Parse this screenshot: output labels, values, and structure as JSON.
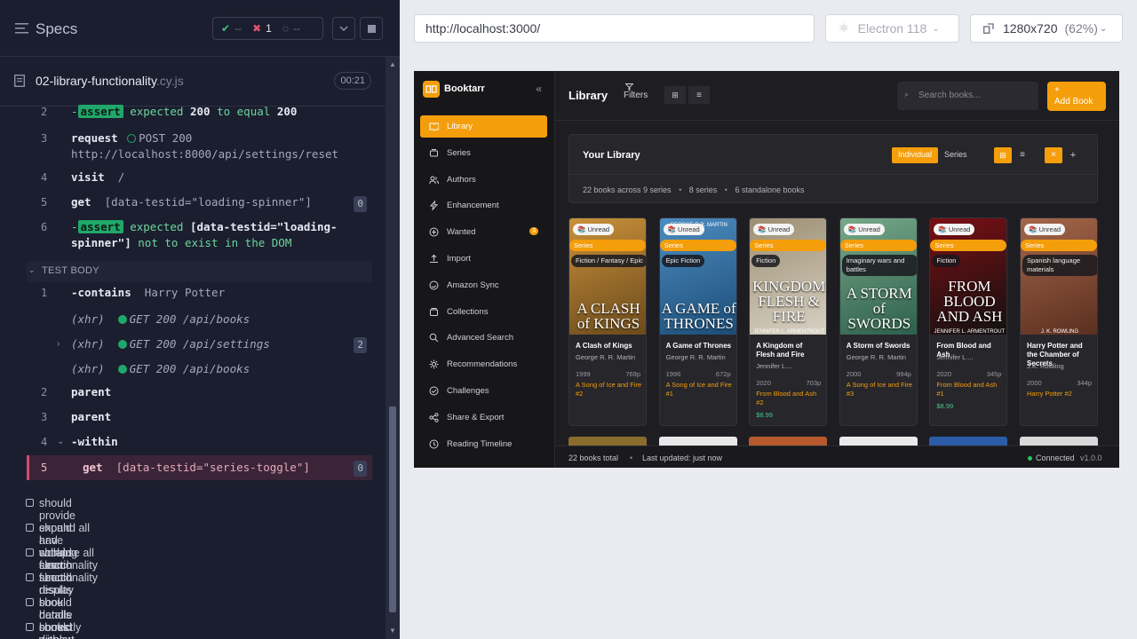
{
  "reporter": {
    "title": "Specs",
    "stats": {
      "passed": "--",
      "failed": "1",
      "pending": "--"
    },
    "file": {
      "name": "02-library-functionality",
      "ext": ".cy.js",
      "duration": "00:21"
    },
    "commands": [
      {
        "num": "2",
        "prefix": "-",
        "badge": "assert",
        "text1": "expected",
        "val1": "200",
        "text2": "to equal",
        "val2": "200"
      },
      {
        "num": "3",
        "name": "request",
        "method": "POST 200",
        "url": "http://localhost:8000/api/settings/reset"
      },
      {
        "num": "4",
        "name": "visit",
        "arg": "/"
      },
      {
        "num": "5",
        "name": "get",
        "arg": "[data-testid=\"loading-spinner\"]",
        "count": "0"
      },
      {
        "num": "6",
        "prefix": "-",
        "badge": "assert",
        "text1": "expected",
        "val1": "[data-testid=\"loading-",
        "val1b": "spinner\"]",
        "text2": "not to exist in the DOM"
      }
    ],
    "test_body_label": "TEST BODY",
    "body": [
      {
        "num": "1",
        "name": "-contains",
        "arg": "Harry Potter"
      },
      {
        "xhr": "(xhr)",
        "req": "GET 200 /api/books"
      },
      {
        "xhr": "(xhr)",
        "req": "GET 200 /api/settings",
        "count": "2"
      },
      {
        "xhr": "(xhr)",
        "req": "GET 200 /api/books"
      },
      {
        "num": "2",
        "name": "parent"
      },
      {
        "num": "3",
        "name": "parent"
      },
      {
        "num": "4",
        "name": "-within"
      },
      {
        "num": "5",
        "name": "get",
        "arg": "[data-testid=\"series-toggle\"]",
        "count": "0"
      }
    ],
    "tests": [
      "should provide expand all and collapse all functionality",
      "should have working search functionality",
      "should clear search results",
      "should display book details correctly",
      "should handle books without series correctly",
      "should display library statistics"
    ]
  },
  "browser": {
    "url": "http://localhost:3000/",
    "browser_name": "Electron 118",
    "viewport": "1280x720",
    "zoom": "(62%)"
  },
  "app": {
    "brand": "Booktarr",
    "nav": [
      {
        "label": "Library",
        "icon": "book-open-icon",
        "active": true
      },
      {
        "label": "Series",
        "icon": "layers-icon"
      },
      {
        "label": "Authors",
        "icon": "users-icon"
      },
      {
        "label": "Enhancement",
        "icon": "bolt-icon"
      },
      {
        "label": "Wanted",
        "icon": "plus-circle-icon",
        "count": "3"
      },
      {
        "label": "Import",
        "icon": "upload-icon"
      },
      {
        "label": "Amazon Sync",
        "icon": "sync-icon"
      },
      {
        "label": "Collections",
        "icon": "folder-icon"
      },
      {
        "label": "Advanced Search",
        "icon": "search-icon"
      },
      {
        "label": "Recommendations",
        "icon": "sparkle-icon"
      },
      {
        "label": "Challenges",
        "icon": "check-circle-icon"
      },
      {
        "label": "Share & Export",
        "icon": "share-icon"
      },
      {
        "label": "Reading Timeline",
        "icon": "clock-icon"
      }
    ],
    "topbar": {
      "title": "Library",
      "filters": "Filters",
      "search_placeholder": "Search books...",
      "add_book": "+ Add Book",
      "add_book_plus": "+",
      "add_book_label": "Add Book"
    },
    "library_card": {
      "title": "Your Library",
      "seg_individual": "Individual",
      "seg_series": "Series",
      "stats": [
        "22 books across 9 series",
        "8 series",
        "6 standalone books"
      ]
    },
    "books": [
      {
        "title": "A Clash of Kings",
        "author": "George R. R. Martin",
        "year": "1999",
        "pages": "769p",
        "series": "A Song of Ice and Fire #2",
        "genre": "Fiction / Fantasy / Epic",
        "status": "Unread",
        "series_chip": "Series",
        "cover_text": "A CLASH of KINGS",
        "colors": [
          "#6b4a1c",
          "#c8903a"
        ]
      },
      {
        "title": "A Game of Thrones",
        "author": "George R. R. Martin",
        "year": "1996",
        "pages": "672p",
        "series": "A Song of Ice and Fire #1",
        "genre": "Epic Fiction",
        "status": "Unread",
        "series_chip": "Series",
        "cover_text": "A GAME of THRONES",
        "cover_top": "GEORGE R.R. MARTIN",
        "colors": [
          "#1c4d78",
          "#4d8cc0"
        ]
      },
      {
        "title": "A Kingdom of Flesh and Fire",
        "author": "Jennifer L....",
        "year": "2020",
        "pages": "703p",
        "series": "From Blood and Ash #2",
        "price": "$8.99",
        "genre": "Fiction",
        "status": "Unread",
        "series_chip": "Series",
        "cover_text": "KINGDOM FLESH & FIRE",
        "cover_auth": "JENNIFER L. ARMENTROUT",
        "colors": [
          "#d8d2c4",
          "#9c8e72"
        ]
      },
      {
        "title": "A Storm of Swords",
        "author": "George R. R. Martin",
        "year": "2000",
        "pages": "994p",
        "series": "A Song of Ice and Fire #3",
        "genre": "Imaginary wars and battles",
        "status": "Unread",
        "series_chip": "Series",
        "cover_text": "A STORM of SWORDS",
        "colors": [
          "#2d5f4c",
          "#78a889"
        ]
      },
      {
        "title": "From Blood and Ash",
        "author": "Jennifer L....",
        "year": "2020",
        "pages": "345p",
        "series": "From Blood and Ash #1",
        "price": "$8.99",
        "genre": "Fiction",
        "status": "Unread",
        "series_chip": "Series",
        "cover_text": "FROM BLOOD AND ASH",
        "cover_auth": "JENNIFER L. ARMENTROUT",
        "colors": [
          "#111111",
          "#7a0f14"
        ]
      },
      {
        "title": "Harry Potter and the Chamber of Secrets",
        "author": "J.K. Rowling",
        "year": "2000",
        "pages": "344p",
        "series": "Harry Potter #2",
        "genre": "Spanish language materials",
        "status": "Unread",
        "series_chip": "Series",
        "cover_text": "",
        "cover_auth": "J. K. ROWLING",
        "colors": [
          "#5b2f1f",
          "#a4674a"
        ]
      }
    ],
    "row2_colors": [
      "#8a6b2e",
      "#e8e8e8",
      "#b65a2e",
      "#e9e9e9",
      "#2c5ba8",
      "#d9d9d9"
    ],
    "footer": {
      "total": "22 books total",
      "updated": "Last updated: just now",
      "status": "Connected",
      "version": "v1.0.0"
    },
    "accent": "#f59e0b"
  }
}
